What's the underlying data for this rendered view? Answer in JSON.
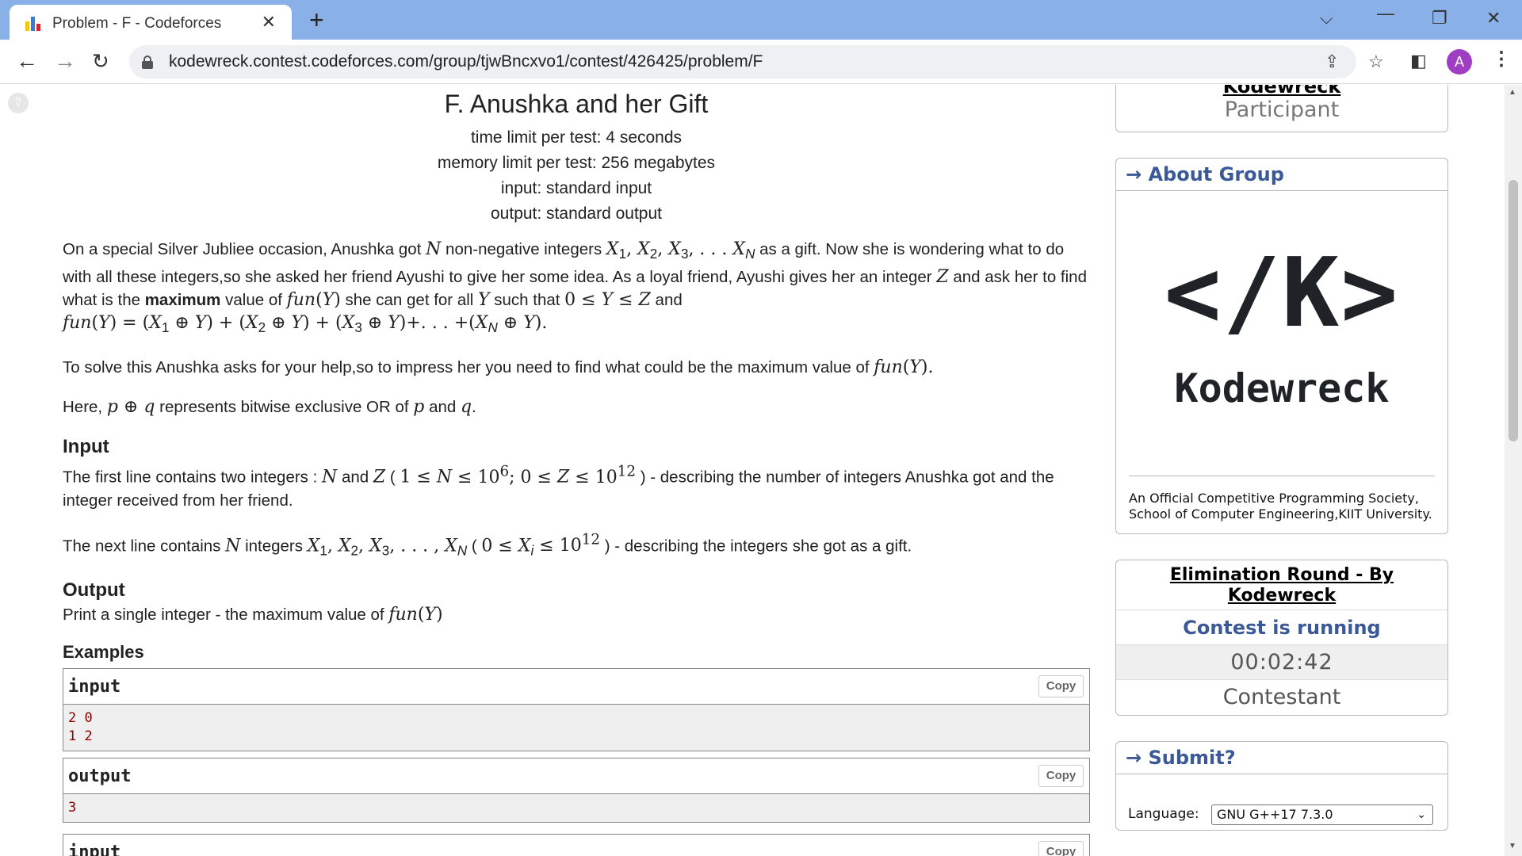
{
  "browser": {
    "tab_title": "Problem - F - Codeforces",
    "url": "kodewreck.contest.codeforces.com/group/tjwBncxvo1/contest/426425/problem/F",
    "profile_initial": "A"
  },
  "problem": {
    "title": "F. Anushka and her Gift",
    "time_limit": "time limit per test: 4 seconds",
    "memory_limit": "memory limit per test: 256 megabytes",
    "input_file": "input: standard input",
    "output_file": "output: standard output",
    "input_heading": "Input",
    "output_heading": "Output",
    "output_text": "Print a single integer - the maximum value of",
    "examples_heading": "Examples",
    "samples": [
      {
        "label": "input",
        "copy": "Copy",
        "content": "2 0\n1 2"
      },
      {
        "label": "output",
        "copy": "Copy",
        "content": "3"
      },
      {
        "label": "input",
        "copy": "Copy",
        "content": ""
      }
    ]
  },
  "sidebar": {
    "group_name": "Kodewreck",
    "participant_role": "Participant",
    "about_caption": "About Group",
    "logo_mark": "</K>",
    "logo_text": "Kodewreck",
    "about_text": "An Official Competitive Programming Society, School of Computer Engineering,KIIT University.",
    "contest_name": "Elimination Round - By Kodewreck",
    "contest_status": "Contest is running",
    "contest_timer": "00:02:42",
    "contest_role": "Contestant",
    "submit_caption": "Submit?",
    "language_label": "Language:",
    "language_value": "GNU G++17 7.3.0"
  },
  "colors": {
    "tabstrip": "#8ab0e8",
    "caption_blue": "#3b5998",
    "sample_text": "#8b0000"
  }
}
